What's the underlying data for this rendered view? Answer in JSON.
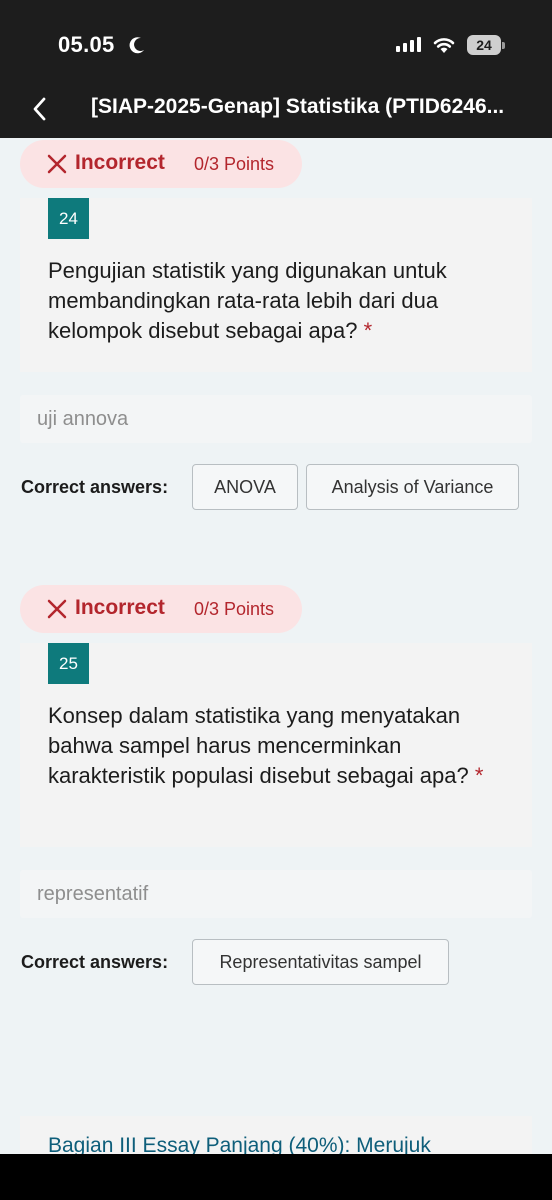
{
  "status_bar": {
    "time": "05.05",
    "battery": "24"
  },
  "nav": {
    "title": "[SIAP-2025-Genap] Statistika (PTID6246..."
  },
  "questions": [
    {
      "result": "Incorrect",
      "points": "0/3 Points",
      "number": "24",
      "text": "Pengujian statistik yang digunakan untuk membandingkan rata-rata lebih dari dua kelompok disebut sebagai apa?",
      "required": "*",
      "answer": "uji annova",
      "correct_label": "Correct answers:",
      "correct_answers": [
        "ANOVA",
        "Analysis of Variance"
      ]
    },
    {
      "result": "Incorrect",
      "points": "0/3 Points",
      "number": "25",
      "text": "Konsep dalam statistika yang menyatakan bahwa sampel harus mencerminkan karakteristik populasi disebut sebagai apa?",
      "required": "*",
      "answer": "representatif",
      "correct_label": "Correct answers:",
      "correct_answers": [
        "Representativitas sampel"
      ]
    }
  ],
  "section": {
    "title": "Bagian III Essay Panjang (40%): Merujuk"
  },
  "colors": {
    "incorrect": "#b3262d",
    "badge_bg": "#fbe3e4",
    "question_number_bg": "#0e7a7c",
    "header_bg": "#1d1d1d"
  }
}
